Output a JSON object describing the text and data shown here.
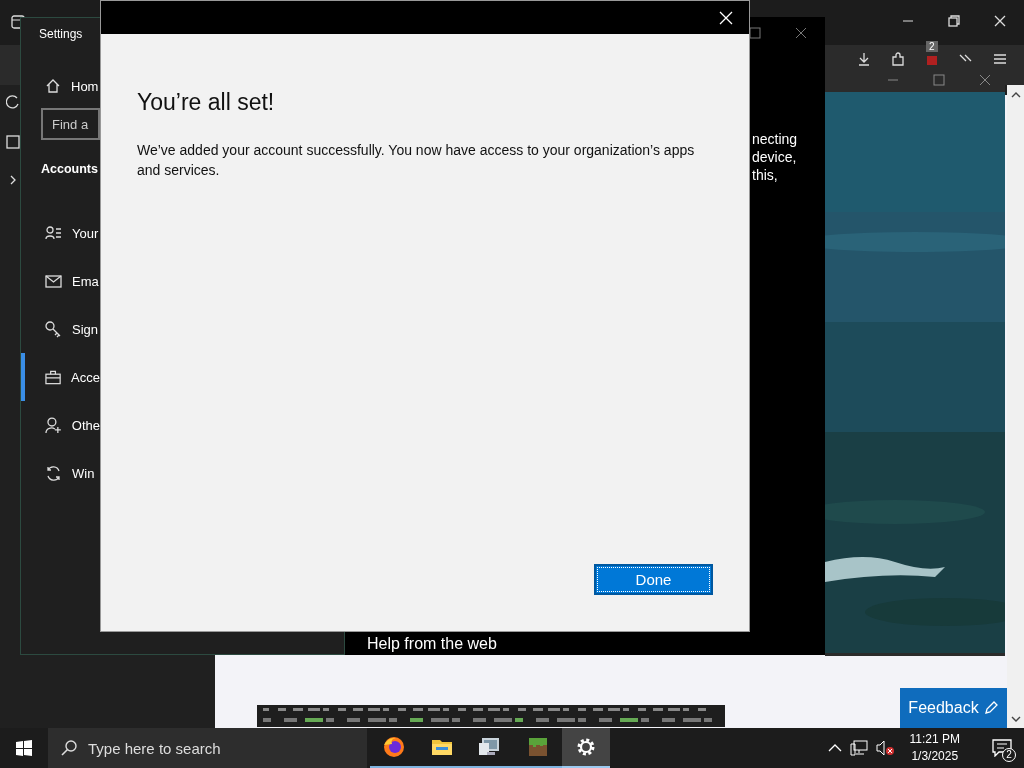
{
  "browser": {
    "extension_badge": "2"
  },
  "background_window": {
    "lines": [
      "necting",
      "device,",
      "this,"
    ],
    "footer": "Help from the web"
  },
  "settings": {
    "title": "Settings",
    "home": "Hom",
    "search_placeholder": "Find a",
    "section": "Accounts",
    "items": [
      {
        "kind": "person-list",
        "label": "Your",
        "selected": false
      },
      {
        "kind": "mail",
        "label": "Ema",
        "selected": false
      },
      {
        "kind": "key",
        "label": "Sign",
        "selected": false
      },
      {
        "kind": "briefcase",
        "label": "Acce",
        "selected": true
      },
      {
        "kind": "person-add",
        "label": "Othe",
        "selected": false
      },
      {
        "kind": "sync",
        "label": "Win",
        "selected": false
      }
    ]
  },
  "dialog": {
    "title": "You’re all set!",
    "message": "We’ve added your account successfully. You now have access to your organization’s apps and services.",
    "button": "Done"
  },
  "feedback": "Feedback",
  "taskbar": {
    "search_placeholder": "Type here to search",
    "apps": [
      {
        "kind": "firefox",
        "selected": false
      },
      {
        "kind": "folder",
        "selected": false
      },
      {
        "kind": "monitor",
        "selected": false
      },
      {
        "kind": "block",
        "selected": false
      },
      {
        "kind": "gear",
        "selected": true
      }
    ],
    "time": "11:21 PM",
    "date": "1/3/2025",
    "notification_count": "2"
  }
}
